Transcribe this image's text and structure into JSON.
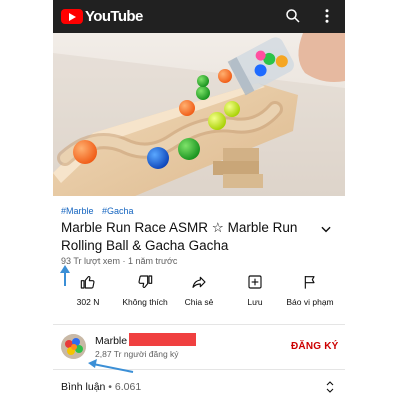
{
  "app": {
    "logo_text": "YouTube"
  },
  "video": {
    "tags": [
      "#Marble",
      "#Gacha"
    ],
    "title": "Marble Run Race ASMR ☆ Marble Run Rolling Ball & Gacha Gacha",
    "views": "93 Tr lượt xem",
    "age": "1 năm trước"
  },
  "actions": {
    "like": "302 N",
    "dislike": "Không thích",
    "share": "Chia sẻ",
    "save": "Lưu",
    "report": "Báo vi phạm"
  },
  "channel": {
    "name": "Marble",
    "subscribers": "2,87 Tr người đăng ký",
    "subscribe_label": "ĐĂNG KÝ"
  },
  "comments": {
    "label": "Bình luận",
    "count": "6.061"
  },
  "colors": {
    "brand_red": "#ff0000",
    "subscribe_red": "#cc0000",
    "tag_blue": "#1565c0",
    "annotation_blue": "#3b8fd6"
  },
  "icons": [
    "search-icon",
    "more-vert-icon",
    "chevron-down-icon",
    "thumb-up-icon",
    "thumb-down-icon",
    "share-icon",
    "add-to-playlist-icon",
    "flag-icon",
    "expand-collapse-icon"
  ]
}
